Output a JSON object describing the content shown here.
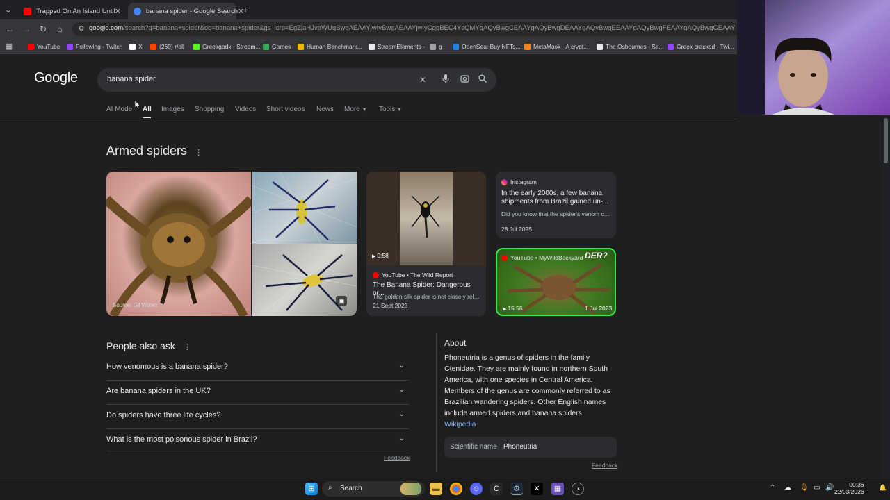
{
  "browser": {
    "tabs": [
      {
        "title": "Trapped On An Island Until I Bu",
        "favicon_color": "#ff0000"
      },
      {
        "title": "banana spider - Google Search",
        "favicon_color": "#4285f4"
      }
    ],
    "new_tab": "+",
    "url_host": "google.com",
    "url_rest": "/search?q=banana+spider&oq=banana+spider&gs_lcrp=EgZjaHJvbWUqBwgAEAAYjwIyBwgAEAAYjwIyCggBEC4YsQMYgAQyBwgCEAAYgAQyBwgDEAAYgAQyBwgEEAAYgAQyBwgFEAAYgAQyBwgGEAAYgAQyBwgHEC",
    "bookmarks": [
      {
        "label": "YouTube",
        "color": "#ff0000"
      },
      {
        "label": "Following - Twitch",
        "color": "#9146ff"
      },
      {
        "label": "X",
        "color": "#ffffff"
      },
      {
        "label": "(269) r/all",
        "color": "#ff4500"
      },
      {
        "label": "Greekgodx - Stream...",
        "color": "#53fc18"
      },
      {
        "label": "Games",
        "color": "#34a853"
      },
      {
        "label": "Human Benchmark...",
        "color": "#f4b400"
      },
      {
        "label": "StreamElements -",
        "color": "#e8eaed"
      },
      {
        "label": "g",
        "color": "#9aa0a6"
      },
      {
        "label": "OpenSea: Buy NFTs,...",
        "color": "#2081e2"
      },
      {
        "label": "MetaMask - A crypt...",
        "color": "#f6851b"
      },
      {
        "label": "The Osbournes - Se...",
        "color": "#e8eaed"
      },
      {
        "label": "Greek cracked - Twi...",
        "color": "#9146ff"
      }
    ]
  },
  "google": {
    "logo": "Google",
    "query": "banana spider",
    "tabs": [
      "AI Mode",
      "All",
      "Images",
      "Shopping",
      "Videos",
      "Short videos",
      "News",
      "More",
      "Tools"
    ],
    "section_title": "Armed spiders",
    "image_source": "Source: Gil Wizen",
    "video1": {
      "duration": "0:58",
      "source": "YouTube • The Wild Report",
      "title": "The Banana Spider: Dangerous or...",
      "snippet": "The golden silk spider is not closely relat...",
      "date": "21 Sept 2023"
    },
    "instagram": {
      "source": "Instagram",
      "title": "In the early 2000s, a few banana shipments from Brazil gained un-...",
      "snippet": "Did you know that the spider's venom can...",
      "date": "28 Jul 2025"
    },
    "video2": {
      "source": "YouTube • MyWildBackyard",
      "duration": "15:56",
      "date": "1 Jul 2023",
      "thumb_text": "DER?"
    },
    "people_also_ask": {
      "title": "People also ask",
      "questions": [
        "How venomous is a banana spider?",
        "Are banana spiders in the UK?",
        "Do spiders have three life cycles?",
        "What is the most poisonous spider in Brazil?"
      ],
      "feedback": "Feedback"
    },
    "about": {
      "title": "About",
      "text": "Phoneutria is a genus of spiders in the family Ctenidae. They are mainly found in northern South America, with one species in Central America. Members of the genus are commonly referred to as Brazilian wandering spiders. Other English names include armed spiders and banana spiders.",
      "link": "Wikipedia",
      "sci_label": "Scientific name",
      "sci_value": "Phoneutria",
      "feedback": "Feedback"
    }
  },
  "taskbar": {
    "search_label": "Search",
    "time": "00:36",
    "date": "22/03/2026"
  }
}
